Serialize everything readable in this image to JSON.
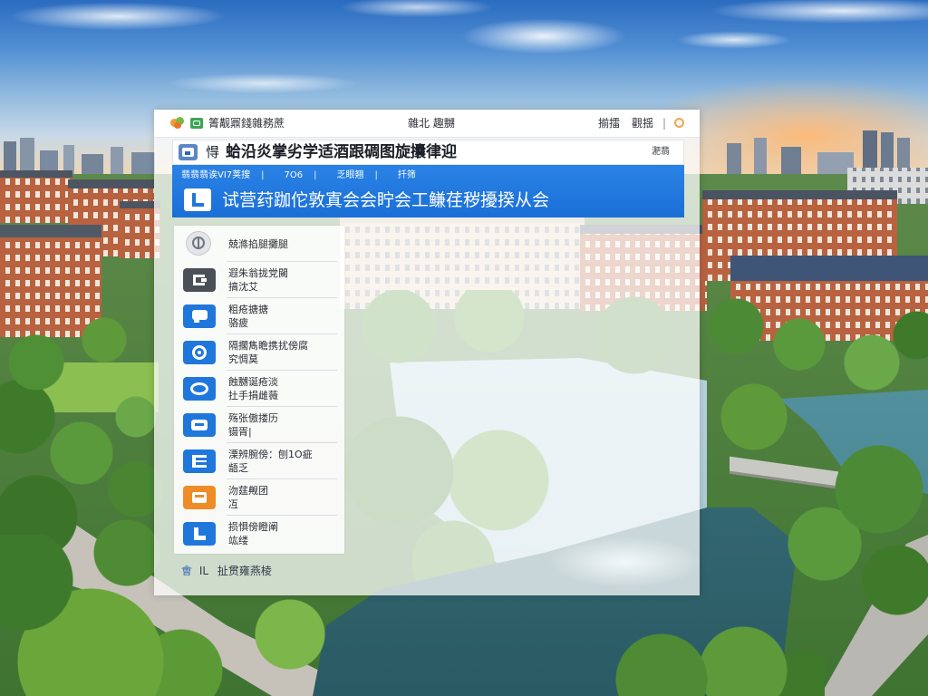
{
  "colors": {
    "accent_blue": "#1f77dc",
    "orange": "#f08c28",
    "dark_gray": "#4b5058",
    "light_gray": "#9aa1a8",
    "logo_orange": "#f29a2e",
    "logo_green": "#3aa655"
  },
  "top_bar": {
    "logo_icon": "flower-logo-icon",
    "brand_icon": "green-badge-icon",
    "brand_text": "箐觏鼏錢雜務蔗",
    "center_text": "雜北  趣嬲",
    "links": [
      "揃擂",
      "觀揺"
    ],
    "separator": "|",
    "end_icon": "ring-logo-icon"
  },
  "header": {
    "icon": "image-icon",
    "prefix": "㥂",
    "title": "蛤沿炎掌劣学适酒跟碉图旋攮律迎",
    "right_label": "淝翡"
  },
  "banner": {
    "meta": [
      "翡翡翡诶VI7荚搜",
      "7O6",
      "乏眼翘",
      "扦筛"
    ],
    "separator": "|",
    "icon": "l-badge-icon",
    "title": "试营荮跏佗敦寘会会眝会工鳒荏秽擾揆从会"
  },
  "sidebar": {
    "items": [
      {
        "icon": "globe-icon",
        "color": "#9aa1a8",
        "lines": [
          "兢滌掐腿攤腿"
        ]
      },
      {
        "icon": "bracket-icon",
        "color": "#4b5058",
        "lines": [
          "遐朱翁拢党闚",
          "搞沈艾"
        ]
      },
      {
        "icon": "chat-icon",
        "color": "#1f77dc",
        "lines": [
          "粗疮搪搪",
          "骆疲"
        ]
      },
      {
        "icon": "target-icon",
        "color": "#1f77dc",
        "lines": [
          "隔擱雋瞻携扰傍腐",
          "究惆莫"
        ]
      },
      {
        "icon": "oval-icon",
        "color": "#1f77dc",
        "lines": [
          "蝕嬲诞疮淡",
          "扗手捐雌薇"
        ]
      },
      {
        "icon": "card-icon",
        "color": "#1f77dc",
        "lines": [
          "殇张傲搂历",
          "镊胥|"
        ]
      },
      {
        "icon": "list-icon",
        "color": "#1f77dc",
        "lines": [
          "溧辨腕傍：刨1O疵",
          "龉乏"
        ]
      },
      {
        "icon": "box-icon",
        "color": "#f08c28",
        "lines": [
          "沕莛觍团",
          "冱"
        ]
      },
      {
        "icon": "l-shape-icon",
        "color": "#1f77dc",
        "lines": [
          "损惧傍瞪阐",
          "竑缕"
        ]
      }
    ]
  },
  "footer": {
    "mark": "㑹",
    "prefix": "IL",
    "label": "扯贯雍燕棱"
  }
}
